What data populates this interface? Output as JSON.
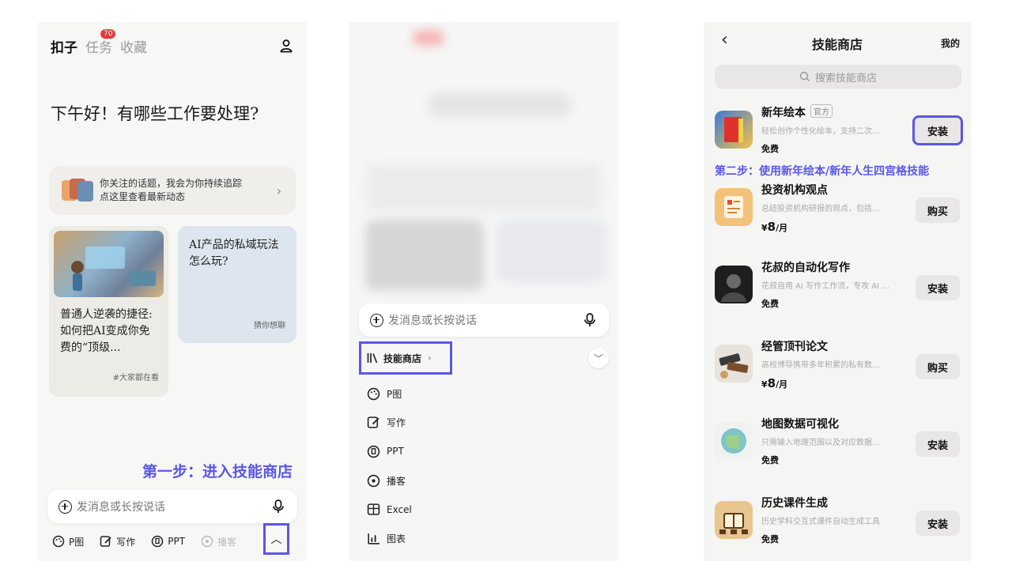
{
  "panel1": {
    "tabs": [
      {
        "label": "扣子",
        "active": true
      },
      {
        "label": "任务",
        "badge": "70"
      },
      {
        "label": "收藏"
      }
    ],
    "greeting": "下午好！有哪些工作要处理?",
    "follow_card": {
      "line1": "你关注的话题，我会为你持续追踪",
      "line2": "点这里查看最新动态"
    },
    "card_a": {
      "title": "普通人逆袭的捷径:如何把AI变成你免费的“顶级...",
      "tag": "#大家都在看"
    },
    "card_b": {
      "title": "AI产品的私域玩法怎么玩?",
      "tag": "猜你想聊"
    },
    "step_label": "第一步：进入技能商店",
    "input_placeholder": "发消息或长按说话",
    "tools": [
      {
        "icon": "palette-icon",
        "label": "P图"
      },
      {
        "icon": "edit-icon",
        "label": "写作"
      },
      {
        "icon": "ppt-icon",
        "label": "PPT"
      },
      {
        "icon": "podcast-icon",
        "label": "播客"
      }
    ]
  },
  "panel2": {
    "input_placeholder": "发消息或长按说话",
    "skill_store_label": "技能商店",
    "menu": [
      {
        "icon": "palette-icon",
        "label": "P图"
      },
      {
        "icon": "edit-icon",
        "label": "写作"
      },
      {
        "icon": "ppt-icon",
        "label": "PPT"
      },
      {
        "icon": "podcast-icon",
        "label": "播客"
      },
      {
        "icon": "table-icon",
        "label": "Excel"
      },
      {
        "icon": "chart-icon",
        "label": "图表"
      }
    ]
  },
  "panel3": {
    "title": "技能商店",
    "mine": "我的",
    "search_placeholder": "搜索技能商店",
    "step_label": "第二步：使用新年绘本/新年人生四宫格技能",
    "items": [
      {
        "name": "新年绘本",
        "official": "官方",
        "desc": "轻松创作个性化绘本，支持二次…",
        "price": "免费",
        "action": "安装"
      },
      {
        "name": "投资机构观点",
        "desc": "总结投资机构研报的观点，包括…",
        "price_symbol": "¥",
        "price_value": "8",
        "price_unit": "/月",
        "action": "购买"
      },
      {
        "name": "花叔的自动化写作",
        "desc": "花叔自用 AI 写作工作流，专攻 AI …",
        "price": "免费",
        "action": "安装"
      },
      {
        "name": "经管顶刊论文",
        "desc": "高校博导携带多年积累的私有数…",
        "price_symbol": "¥",
        "price_value": "8",
        "price_unit": "/月",
        "action": "购买"
      },
      {
        "name": "地图数据可视化",
        "desc": "只需输入地理范围以及对应数据…",
        "price": "免费",
        "action": "安装"
      },
      {
        "name": "历史课件生成",
        "desc": "历史学科交互式课件自动生成工具",
        "price": "免费",
        "action": "安装"
      }
    ]
  },
  "colors": {
    "accent": "#5a57e6",
    "badge": "#e33b3b"
  }
}
